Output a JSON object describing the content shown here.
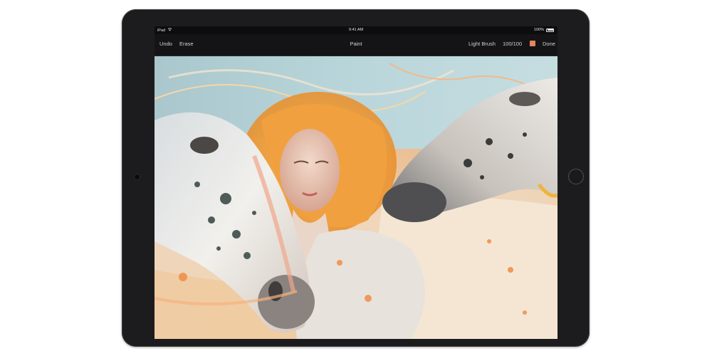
{
  "status": {
    "device": "iPad",
    "wifi_icon": "wifi-icon",
    "time": "9:41 AM",
    "battery": "100%"
  },
  "toolbar": {
    "undo_label": "Undo",
    "erase_label": "Erase",
    "title": "Paint",
    "brush_label": "Light Brush",
    "brush_level": "100/100",
    "brush_color": "#e8845f",
    "done_label": "Done"
  },
  "canvas": {
    "description_icon": "painting-canvas"
  }
}
